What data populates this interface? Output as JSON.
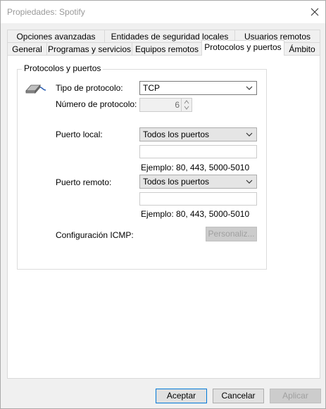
{
  "window": {
    "title": "Propiedades: Spotify"
  },
  "tabs": {
    "row1": [
      {
        "label": "Opciones avanzadas"
      },
      {
        "label": "Entidades de seguridad locales"
      },
      {
        "label": "Usuarios remotos"
      }
    ],
    "row2": [
      {
        "label": "General"
      },
      {
        "label": "Programas y servicios"
      },
      {
        "label": "Equipos remotos"
      },
      {
        "label": "Protocolos y puertos",
        "active": true
      },
      {
        "label": "Ámbito"
      }
    ]
  },
  "group": {
    "title": "Protocolos y puertos"
  },
  "protocol": {
    "type_label": "Tipo de protocolo:",
    "type_value": "TCP",
    "number_label": "Número de protocolo:",
    "number_value": "6"
  },
  "local_port": {
    "label": "Puerto local:",
    "value": "Todos los puertos",
    "example": "Ejemplo: 80, 443, 5000-5010"
  },
  "remote_port": {
    "label": "Puerto remoto:",
    "value": "Todos los puertos",
    "example": "Ejemplo: 80, 443, 5000-5010"
  },
  "icmp": {
    "label": "Configuración ICMP:",
    "button_label": "Personaliz..."
  },
  "footer": {
    "ok_label": "Aceptar",
    "cancel_label": "Cancelar",
    "apply_label": "Aplicar"
  },
  "icons": {
    "close": "close-icon",
    "protocol": "network-cable-icon",
    "dropdown": "chevron-down-icon",
    "spin_up": "spin-up-icon",
    "spin_down": "spin-down-icon"
  },
  "colors": {
    "accent_border": "#0078d7",
    "panel_bg": "#ffffff",
    "window_bg": "#f0f0f0"
  }
}
